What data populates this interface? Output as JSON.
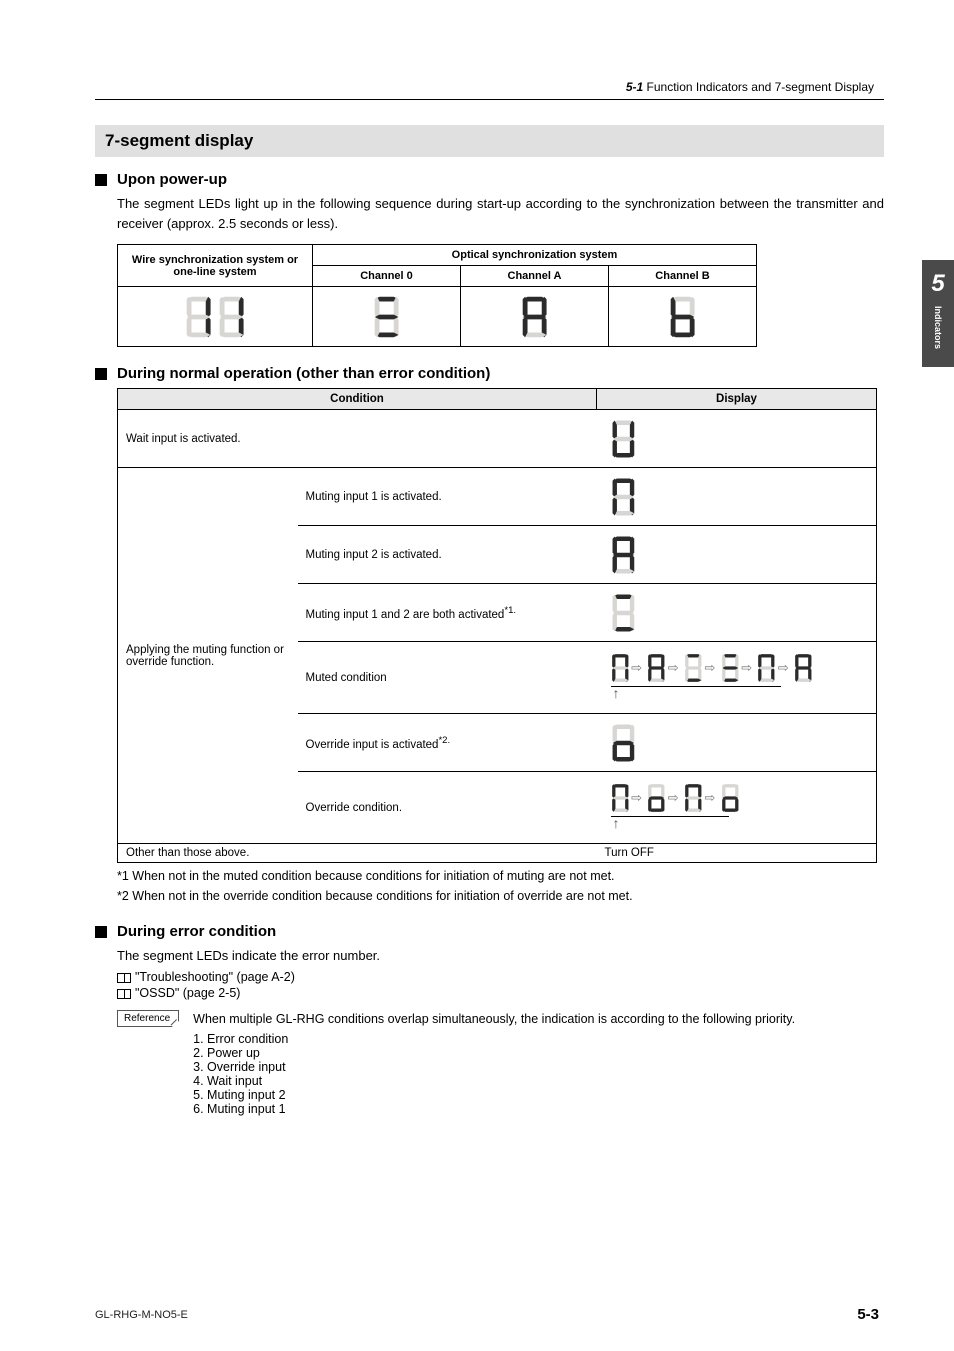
{
  "running_header": {
    "section_num": "5-1",
    "section_title": "Function Indicators and 7-segment Display"
  },
  "side_tab": {
    "number": "5",
    "label": "Indicators"
  },
  "h1": "7-segment display",
  "sub_powerup": {
    "title": "Upon power-up",
    "para": "The segment LEDs light up in the following sequence during start-up according to the synchronization between the transmitter and receiver (approx. 2.5 seconds or less)."
  },
  "sync_table": {
    "head_wire_1": "Wire synchronization system or",
    "head_wire_2": "one-line system",
    "head_optical": "Optical synchronization system",
    "ch0": "Channel 0",
    "chA": "Channel A",
    "chB": "Channel B"
  },
  "sub_normal": {
    "title": "During normal operation (other than error condition)"
  },
  "cond_table": {
    "head_condition": "Condition",
    "head_display": "Display",
    "r_wait": "Wait input is activated.",
    "r_group": "Applying the muting function or override function.",
    "r_m1": "Muting input 1 is activated.",
    "r_m2": "Muting input 2 is activated.",
    "r_m12": "Muting input 1 and 2 are both activated",
    "r_m12_sup": "*1.",
    "r_muted": "Muted condition",
    "r_ovr_in": "Override input is activated",
    "r_ovr_in_sup": "*2.",
    "r_ovr_cond": "Override condition.",
    "r_other": "Other than those above.",
    "r_other_disp": "Turn OFF"
  },
  "footnotes": {
    "f1": "*1  When not in the muted condition because conditions for initiation of muting are not met.",
    "f2": "*2  When not in the override condition because conditions for initiation of override are not met."
  },
  "sub_error": {
    "title": "During error condition",
    "para": "The segment LEDs indicate the error number.",
    "xref1": "\"Troubleshooting\" (page A-2)",
    "xref2": "\"OSSD\" (page 2-5)"
  },
  "reference": {
    "label": "Reference",
    "text": "When multiple GL-RHG conditions overlap simultaneously, the indication is according to the following priority.",
    "items": [
      "1. Error condition",
      "2. Power up",
      "3. Override input",
      "4. Wait input",
      "5. Muting input 2",
      "6. Muting input 1"
    ]
  },
  "footer": {
    "left": "GL-RHG-M-NO5-E",
    "right": "5-3"
  }
}
